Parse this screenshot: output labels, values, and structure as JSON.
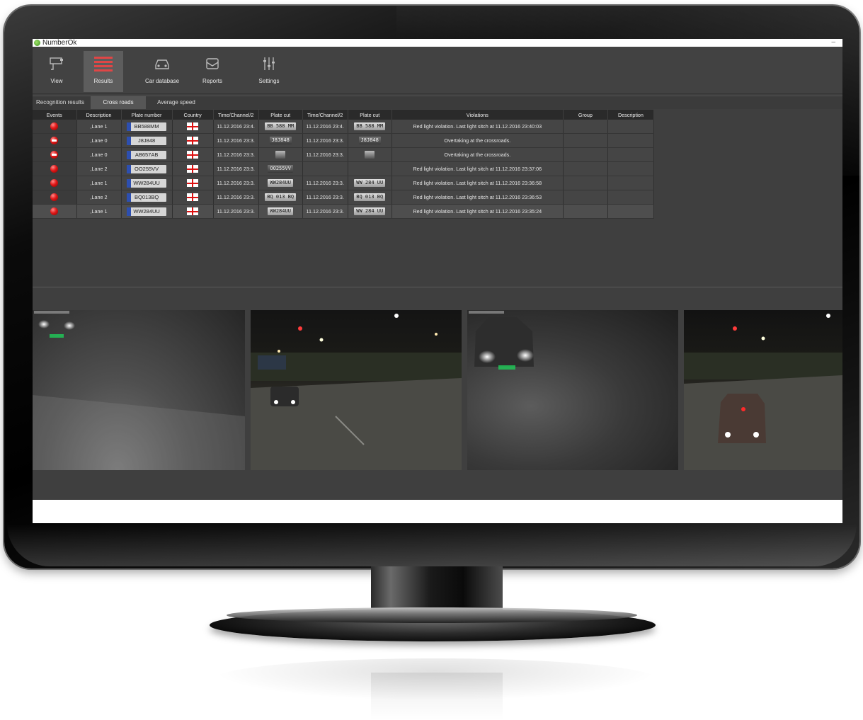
{
  "app": {
    "title": "NumberOk",
    "minimize_glyph": "–"
  },
  "ribbon": [
    {
      "label": "View",
      "icon": "camera-icon",
      "active": false
    },
    {
      "label": "Results",
      "icon": "results-list-icon",
      "active": true
    },
    {
      "label": "Car database",
      "icon": "car-icon",
      "active": false
    },
    {
      "label": "Reports",
      "icon": "envelope-icon",
      "active": false
    },
    {
      "label": "Settings",
      "icon": "sliders-icon",
      "active": false
    }
  ],
  "tabs": [
    {
      "label": "Recognition results",
      "active": false
    },
    {
      "label": "Cross roads",
      "active": true
    },
    {
      "label": "Average speed",
      "active": false
    }
  ],
  "table": {
    "headers": [
      "Events",
      "Description",
      "Plate number",
      "Country",
      "Time/Channel/2",
      "Plate cut",
      "Time/Channel/2",
      "Plate cut",
      "Violations",
      "Group",
      "Description"
    ],
    "rows": [
      {
        "event": "red-light",
        "lane": ",Lane 1",
        "plate": "BB588MM",
        "time1": "11.12.2016 23:4.",
        "cut1": "BB 588 MM",
        "time2": "11.12.2016 23:4.",
        "cut2": "BB 588 MM",
        "violation": "Red light violation. Last light sitch at 11.12.2016 23:40:03"
      },
      {
        "event": "no-entry",
        "lane": ",Lane 0",
        "plate": "J8J848",
        "time1": "11.12.2016 23:3.",
        "cut1": "J8J848",
        "time2": "11.12.2016 23:3.",
        "cut2": "J8J848",
        "violation": "Overtaking at the crossroads."
      },
      {
        "event": "no-entry",
        "lane": ",Lane 0",
        "plate": "AB657AB",
        "time1": "11.12.2016 23:3.",
        "cut1": "",
        "time2": "11.12.2016 23:3.",
        "cut2": "",
        "violation": "Overtaking at the crossroads."
      },
      {
        "event": "red-light",
        "lane": ",Lane 2",
        "plate": "OO255VV",
        "time1": "11.12.2016 23:3.",
        "cut1": "OO255VV",
        "time2": "",
        "cut2": "",
        "violation": "Red light violation. Last light sitch at 11.12.2016 23:37:06"
      },
      {
        "event": "red-light",
        "lane": ",Lane 1",
        "plate": "WW284UU",
        "time1": "11.12.2016 23:3.",
        "cut1": "WW284UU",
        "time2": "11.12.2016 23:3.",
        "cut2": "WW 284 UU",
        "violation": "Red light violation. Last light sitch at 11.12.2016 23:36:58"
      },
      {
        "event": "red-light",
        "lane": ",Lane 2",
        "plate": "BQ013BQ",
        "time1": "11.12.2016 23:3.",
        "cut1": "BQ 013 BQ",
        "time2": "11.12.2016 23:3.",
        "cut2": "BQ 013 BQ",
        "violation": "Red light violation. Last light sitch at 11.12.2016 23:36:53"
      },
      {
        "event": "red-light",
        "lane": ",Lane 1",
        "plate": "WW284UU",
        "time1": "11.12.2016 23:3.",
        "cut1": "WW284UU",
        "time2": "11.12.2016 23:3.",
        "cut2": "WW 284 UU",
        "violation": "Red light violation. Last light sitch at 11.12.2016 23:35:24"
      }
    ]
  },
  "cameras": [
    {
      "name": "camera-feed-1",
      "scene": "fog-headlights"
    },
    {
      "name": "camera-feed-2",
      "scene": "intersection-car-left"
    },
    {
      "name": "camera-feed-3",
      "scene": "fog-car-close"
    },
    {
      "name": "camera-feed-4",
      "scene": "intersection-car-close"
    }
  ],
  "colors": {
    "accent_red": "#e01818",
    "selected_tab": "#565656",
    "window_bg": "#3f3f3f"
  }
}
